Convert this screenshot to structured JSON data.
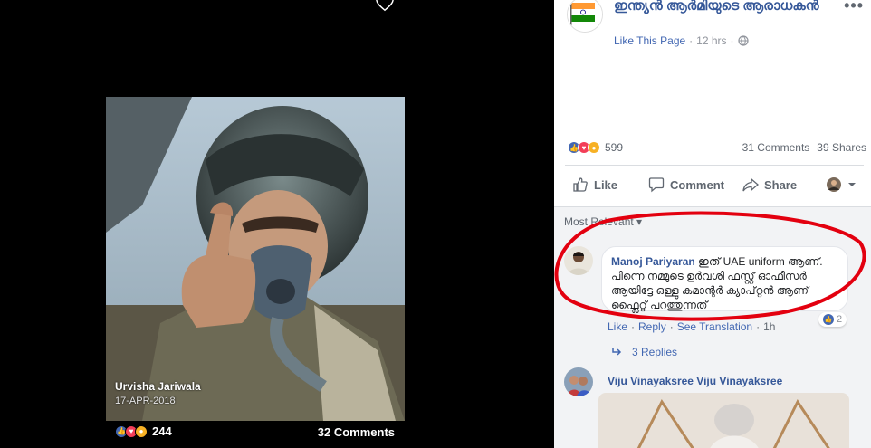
{
  "viewer": {
    "caption_name": "Urvisha Jariwala",
    "caption_date": "17-APR-2018",
    "reactions_count": "244",
    "comments_count": "32 Comments"
  },
  "post": {
    "page_name": "ഇന്ത്യൻ ആർമിയുടെ ആരാധകൻ",
    "like_page": "Like This Page",
    "separator": "·",
    "time": "12 hrs",
    "more": "•••"
  },
  "stats": {
    "reactions_count": "599",
    "comments": "31 Comments",
    "shares": "39 Shares"
  },
  "actions": {
    "like": "Like",
    "comment": "Comment",
    "share": "Share"
  },
  "comments": {
    "sort_label": "Most Relevant ▾",
    "first": {
      "author": "Manoj Pariyaran",
      "text": "ഇത് UAE uniform ആണ്. പിന്നെ നമ്മുടെ ഉർവശി ഫസ്റ്റ് ഓഫീസർ ആയിട്ടേ ഒള്ളു കമാന്റർ ക്യാപ്റ്റൻ ആണ് ഫ്ലൈറ്റ് പറത്തുന്നത്",
      "like": "Like",
      "reply": "Reply",
      "see_translation": "See Translation",
      "time": "1h",
      "likes": "2"
    },
    "replies_label": "3 Replies",
    "second": {
      "author": "Viju Vinayaksree Viju Vinayaksree"
    }
  },
  "colors": {
    "link_blue": "#365899",
    "like_blue": "#4267b2",
    "annotation_red": "#e3000f",
    "viewer_bg": "#000000"
  }
}
